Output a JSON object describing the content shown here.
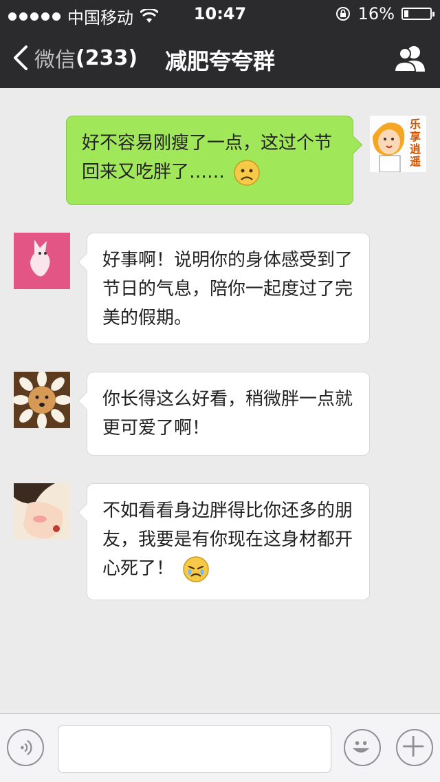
{
  "status_bar": {
    "carrier": "中国移动",
    "time": "10:47",
    "battery_percent": "16%",
    "battery_level": 0.16
  },
  "nav": {
    "back_label": "微信",
    "back_count": "(233)",
    "title": "减肥夸夸群"
  },
  "messages": [
    {
      "side": "sent",
      "text": "好不容易刚瘦了一点，这过个节回来又吃胖了……",
      "emoji": "frown-face-icon",
      "avatar_caption": "乐享逍遥"
    },
    {
      "side": "received",
      "text": "好事啊！说明你的身体感受到了节日的气息，陪你一起度过了完美的假期。"
    },
    {
      "side": "received",
      "text": "你长得这么好看，稍微胖一点就更可爱了啊！"
    },
    {
      "side": "received",
      "text": "不如看看身边胖得比你还多的朋友，我要是有你现在这身材都开心死了！",
      "emoji": "crying-face-icon"
    }
  ],
  "input_bar": {
    "input_value": "",
    "input_placeholder": ""
  },
  "colors": {
    "nav_bg": "#2b2b2d",
    "chat_bg": "#ebebeb",
    "sent_bubble": "#a0e75a",
    "received_bubble": "#ffffff"
  }
}
